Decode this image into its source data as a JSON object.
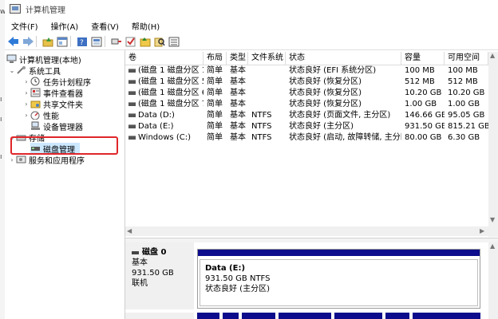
{
  "window": {
    "title": "计算机管理"
  },
  "menu": [
    "文件(F)",
    "操作(A)",
    "查看(V)",
    "帮助(H)"
  ],
  "toolbar": {
    "icons": [
      "back-arrow-icon",
      "forward-arrow-icon",
      "up-folder-icon",
      "properties-icon",
      "help-icon",
      "console-icon",
      "connect-icon",
      "check-icon",
      "yellow-folder-icon",
      "search-icon",
      "list-view-icon"
    ]
  },
  "tree": {
    "root": "计算机管理(本地)",
    "system_tools": "系统工具",
    "task_scheduler": "任务计划程序",
    "event_viewer": "事件查看器",
    "shared_folders": "共享文件夹",
    "performance": "性能",
    "device_manager": "设备管理器",
    "storage": "存储",
    "disk_management": "磁盘管理",
    "services": "服务和应用程序"
  },
  "volumes": {
    "columns": [
      "卷",
      "布局",
      "类型",
      "文件系统",
      "状态",
      "容量",
      "可用空间"
    ],
    "rows": [
      [
        "(磁盘 1 磁盘分区 1)",
        "简单",
        "基本",
        "",
        "状态良好 (EFI 系统分区)",
        "100 MB",
        "100 MB"
      ],
      [
        "(磁盘 1 磁盘分区 5)",
        "简单",
        "基本",
        "",
        "状态良好 (恢复分区)",
        "512 MB",
        "512 MB"
      ],
      [
        "(磁盘 1 磁盘分区 6)",
        "简单",
        "基本",
        "",
        "状态良好 (恢复分区)",
        "10.20 GB",
        "10.20 GB"
      ],
      [
        "(磁盘 1 磁盘分区 7)",
        "简单",
        "基本",
        "",
        "状态良好 (恢复分区)",
        "1.00 GB",
        "1.00 GB"
      ],
      [
        "Data (D:)",
        "简单",
        "基本",
        "NTFS",
        "状态良好 (页面文件, 主分区)",
        "146.66 GB",
        "95.05 GB"
      ],
      [
        "Data (E:)",
        "简单",
        "基本",
        "NTFS",
        "状态良好 (主分区)",
        "931.50 GB",
        "815.21 GB"
      ],
      [
        "Windows (C:)",
        "简单",
        "基本",
        "NTFS",
        "状态良好 (启动, 故障转储, 主分区)",
        "80.00 GB",
        "6.30 GB"
      ]
    ]
  },
  "disk0": {
    "name": "磁盘 0",
    "type": "基本",
    "size": "931.50 GB",
    "status": "联机",
    "partition": {
      "name": "Data  (E:)",
      "size_fs": "931.50 GB NTFS",
      "status": "状态良好 (主分区)"
    }
  },
  "disk1": {
    "name": "磁盘 1"
  },
  "colors": {
    "partition_bar": "#0c0c8c",
    "selection": "#cce8ff",
    "highlight_box": "#e0262a"
  }
}
